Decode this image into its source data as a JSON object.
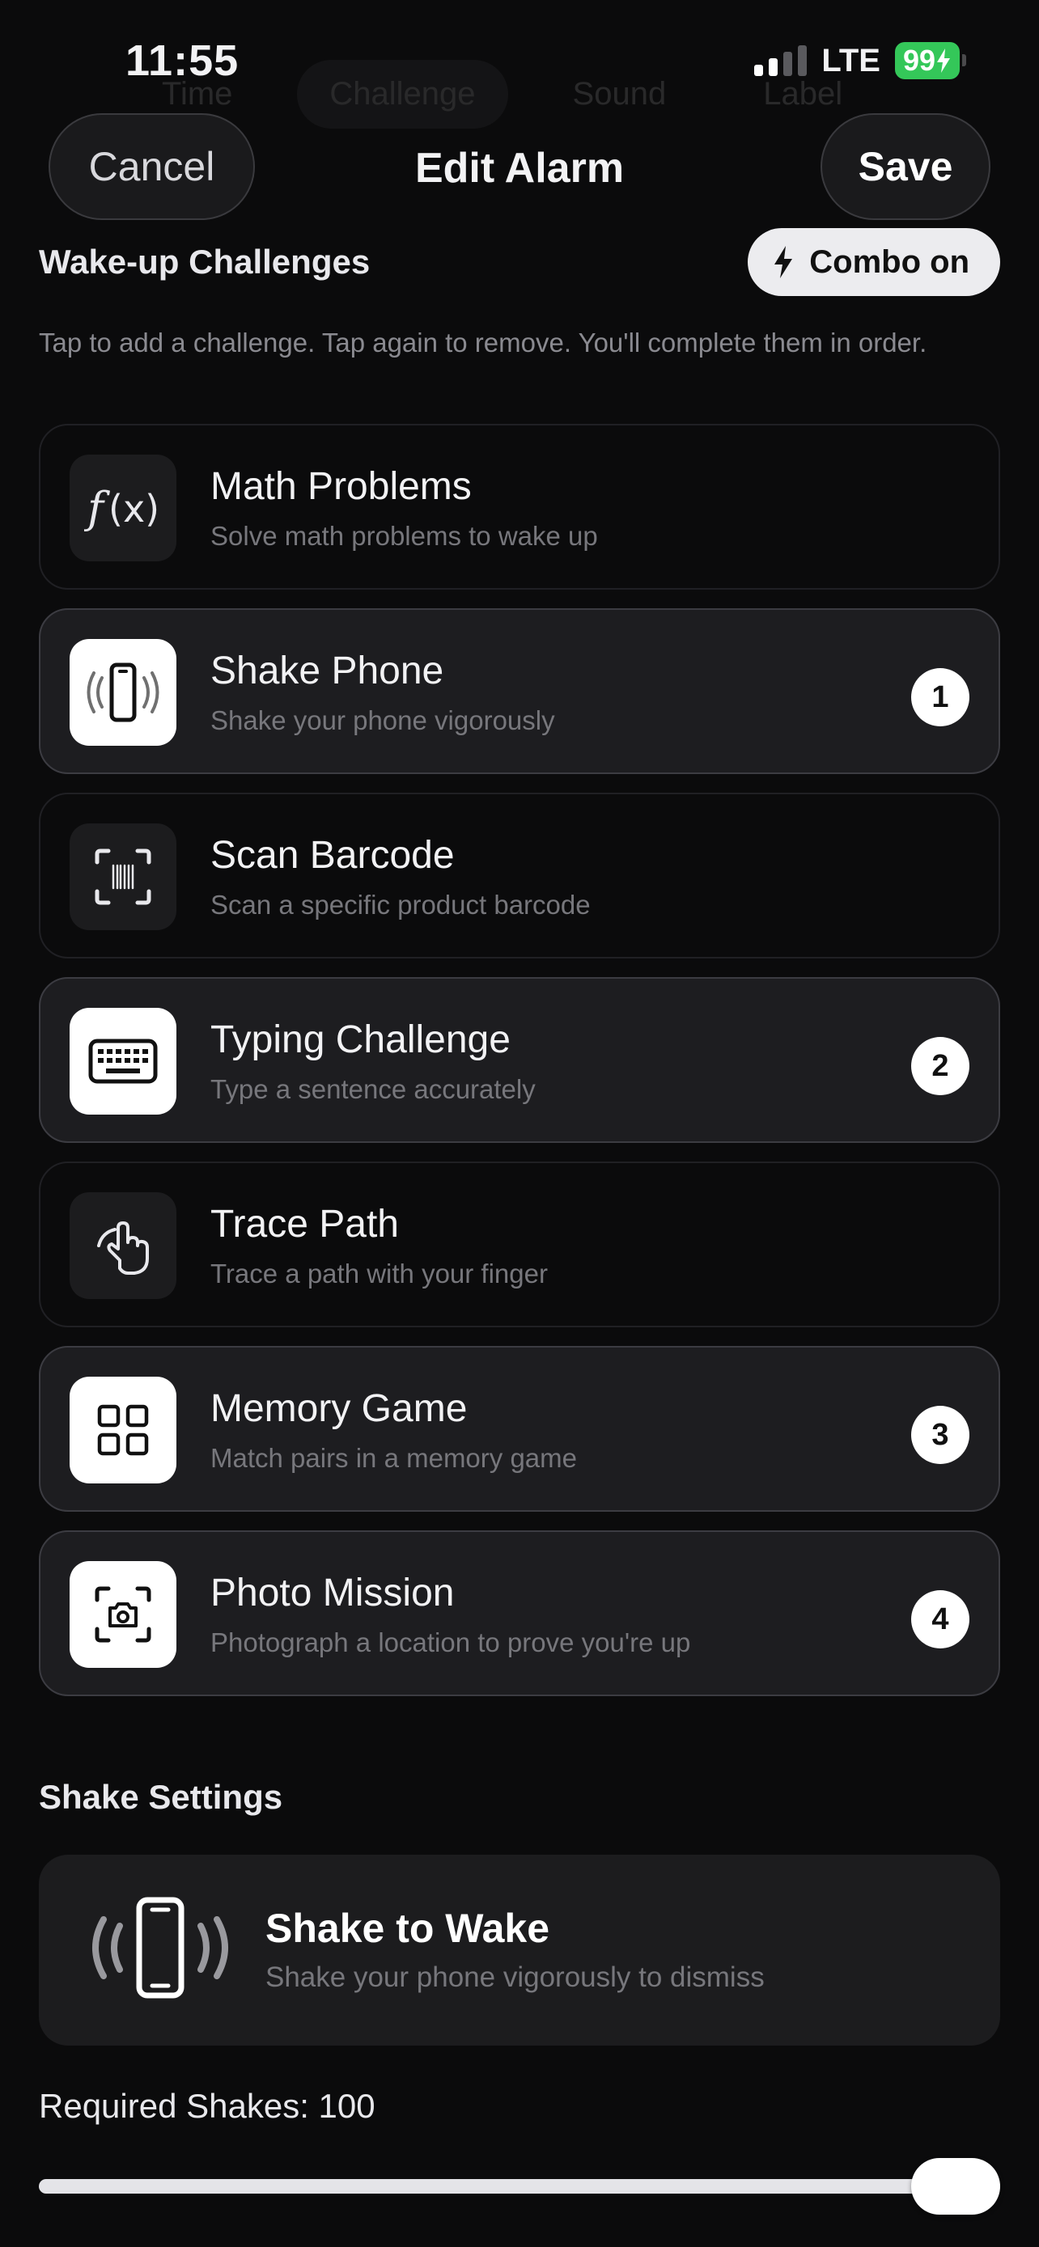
{
  "status": {
    "time": "11:55",
    "network": "LTE",
    "battery": "99"
  },
  "ghost_tabs": [
    "Time",
    "Challenge",
    "Sound",
    "Label"
  ],
  "header": {
    "cancel": "Cancel",
    "title": "Edit Alarm",
    "save": "Save"
  },
  "challenges": {
    "title": "Wake-up Challenges",
    "combo_label": "Combo on",
    "help": "Tap to add a challenge. Tap again to remove. You'll complete them in order.",
    "items": [
      {
        "name": "Math Problems",
        "desc": "Solve math problems to wake up",
        "icon": "function-icon",
        "selected": false,
        "order": ""
      },
      {
        "name": "Shake Phone",
        "desc": "Shake your phone vigorously",
        "icon": "shaking-phone-icon",
        "selected": true,
        "order": "1"
      },
      {
        "name": "Scan Barcode",
        "desc": "Scan a specific product barcode",
        "icon": "barcode-scan-icon",
        "selected": false,
        "order": ""
      },
      {
        "name": "Typing Challenge",
        "desc": "Type a sentence accurately",
        "icon": "keyboard-icon",
        "selected": true,
        "order": "2"
      },
      {
        "name": "Trace Path",
        "desc": "Trace a path with your finger",
        "icon": "hand-pointer-icon",
        "selected": false,
        "order": ""
      },
      {
        "name": "Memory Game",
        "desc": "Match pairs in a memory game",
        "icon": "grid-icon",
        "selected": true,
        "order": "3"
      },
      {
        "name": "Photo Mission",
        "desc": "Photograph a location to prove you're up",
        "icon": "camera-scan-icon",
        "selected": true,
        "order": "4"
      }
    ]
  },
  "shake_settings": {
    "title": "Shake Settings",
    "card_title": "Shake to Wake",
    "card_desc": "Shake your phone vigorously to dismiss",
    "required_label": "Required Shakes: 100",
    "slider_fraction": 1.0
  },
  "colors": {
    "background": "#0b0b0c",
    "battery": "#34c759",
    "selected_card": "#1d1d20"
  }
}
